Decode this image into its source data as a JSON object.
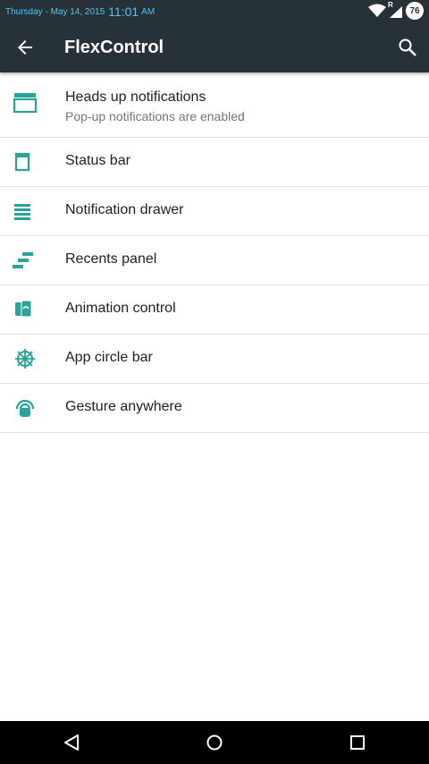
{
  "status_bar": {
    "date": "Thursday - May 14, 2015",
    "time": "11:01",
    "ampm": "AM",
    "signal_label": "R",
    "battery_level": "76",
    "icons": [
      "wifi-icon",
      "signal-icon",
      "battery-icon"
    ]
  },
  "app_bar": {
    "title": "FlexControl",
    "back_icon": "arrow-back-icon",
    "search_icon": "search-icon"
  },
  "menu": {
    "items": [
      {
        "label": "Heads up notifications",
        "sublabel": "Pop-up notifications are enabled",
        "icon": "heads-up-icon"
      },
      {
        "label": "Status bar",
        "icon": "status-bar-icon"
      },
      {
        "label": "Notification drawer",
        "icon": "notification-drawer-icon"
      },
      {
        "label": "Recents panel",
        "icon": "recents-panel-icon"
      },
      {
        "label": "Animation control",
        "icon": "animation-control-icon"
      },
      {
        "label": "App circle bar",
        "icon": "app-circle-bar-icon"
      },
      {
        "label": "Gesture anywhere",
        "icon": "gesture-anywhere-icon"
      }
    ]
  },
  "nav_bar": {
    "icons": [
      "back-nav-icon",
      "home-nav-icon",
      "recents-nav-icon"
    ]
  },
  "colors": {
    "toolbar": "#263238",
    "status_text": "#4fc3f7",
    "accent": "#26a69a",
    "divider": "#e0e0e0"
  }
}
